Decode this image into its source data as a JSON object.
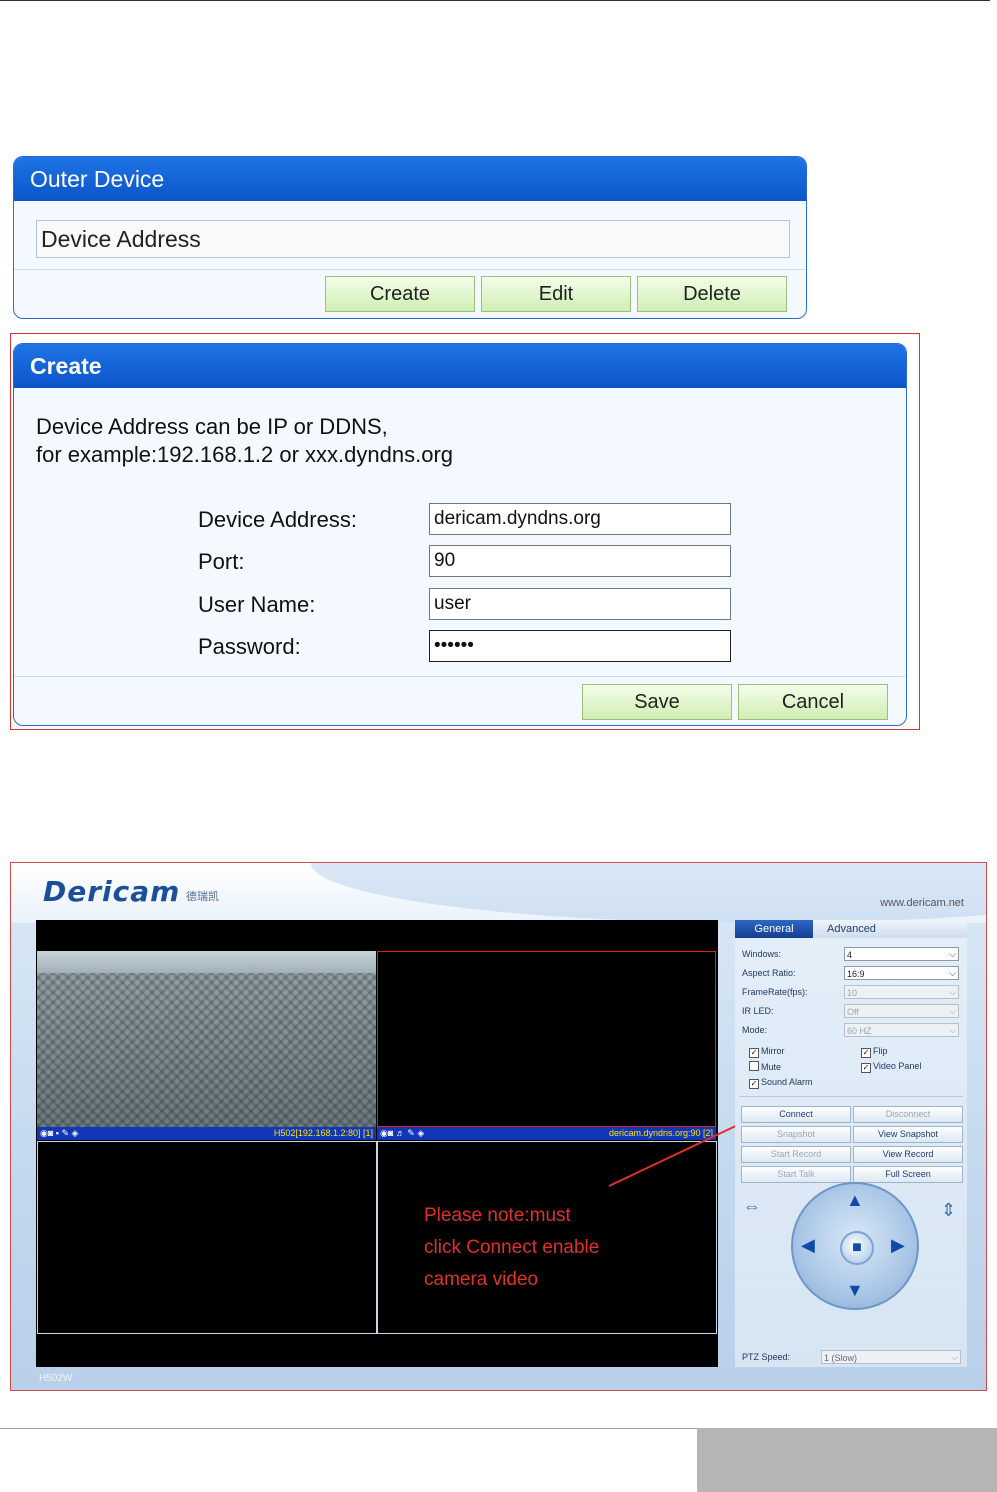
{
  "outer_device": {
    "title": "Outer Device",
    "list_item": "Device Address",
    "buttons": {
      "create": "Create",
      "edit": "Edit",
      "delete": "Delete"
    }
  },
  "create_dialog": {
    "title": "Create",
    "info_line1": "Device Address can be IP or DDNS,",
    "info_line2": "for example:192.168.1.2 or xxx.dyndns.org",
    "fields": {
      "address_label": "Device Address:",
      "address_value": "dericam.dyndns.org",
      "port_label": "Port:",
      "port_value": "90",
      "user_label": "User Name:",
      "user_value": "user",
      "password_label": "Password:",
      "password_value": "••••••"
    },
    "buttons": {
      "save": "Save",
      "cancel": "Cancel"
    }
  },
  "app": {
    "logo": "Dericam",
    "logo_sub": "德瑞凯",
    "website": "www.dericam.net",
    "model": "H502W",
    "video": {
      "cam1_icons": "◉◙ ▪ ✎ ◈",
      "cam1_label": "H502[192.168.1.2:80] [1]",
      "cam2_icons": "◉◙ ♬ ✎ ◈",
      "cam2_label": "dericam.dyndns.org:90 [2]"
    },
    "note": {
      "line1": "Please note:must",
      "line2": "click Connect enable",
      "line3": "camera video"
    },
    "tabs": {
      "general": "General",
      "advanced": "Advanced"
    },
    "settings": {
      "windows_label": "Windows:",
      "windows_value": "4",
      "aspect_label": "Aspect Ratio:",
      "aspect_value": "16:9",
      "framerate_label": "FrameRate(fps):",
      "framerate_value": "10",
      "irled_label": "IR LED:",
      "irled_value": "Off",
      "mode_label": "Mode:",
      "mode_value": "60 HZ"
    },
    "checkboxes": {
      "mirror": "Mirror",
      "flip": "Flip",
      "mute": "Mute",
      "video_panel": "Video Panel",
      "sound_alarm": "Sound Alarm"
    },
    "buttons": {
      "connect": "Connect",
      "disconnect": "Disconnect",
      "snapshot": "Snapshot",
      "view_snapshot": "View Snapshot",
      "start_record": "Start Record",
      "view_record": "View Record",
      "start_talk": "Start Talk",
      "full_screen": "Full Screen"
    },
    "ptz_speed_label": "PTZ Speed:",
    "ptz_speed_value": "1 (Slow)"
  },
  "colors": {
    "panel_header": "#0b55c9",
    "note": "#e0302a",
    "video_bar": "#1236b8"
  }
}
